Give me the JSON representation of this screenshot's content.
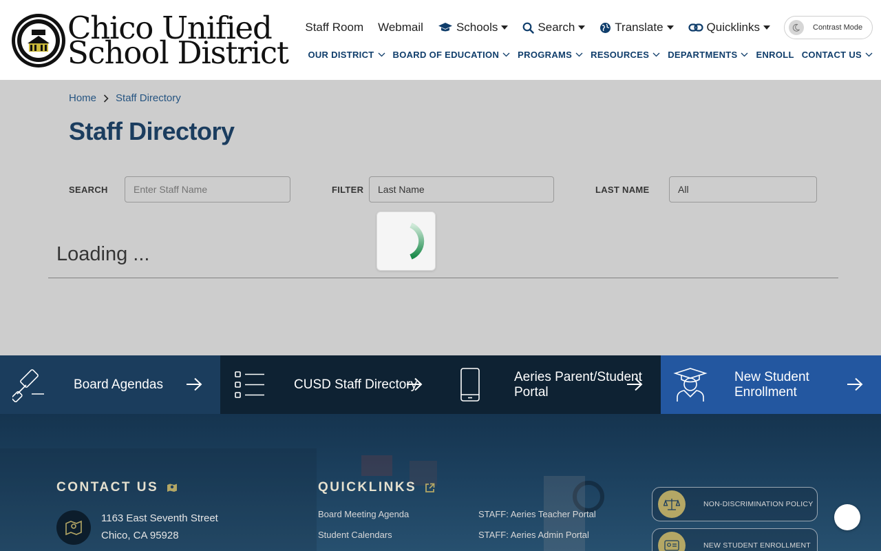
{
  "logo": {
    "line1": "Chico Unified",
    "line2": "School District"
  },
  "utility_nav": {
    "staff_room": "Staff Room",
    "webmail": "Webmail",
    "schools": "Schools",
    "search": "Search",
    "translate": "Translate",
    "quicklinks": "Quicklinks",
    "contrast_mode": "Contrast Mode"
  },
  "main_nav": {
    "our_district": "OUR DISTRICT",
    "board_of_education": "BOARD OF EDUCATION",
    "programs": "PROGRAMS",
    "resources": "RESOURCES",
    "departments": "DEPARTMENTS",
    "enroll": "ENROLL",
    "contact_us": "CONTACT US"
  },
  "breadcrumb": {
    "home": "Home",
    "current": "Staff Directory"
  },
  "page_title": "Staff Directory",
  "filters": {
    "search_label": "SEARCH",
    "search_placeholder": "Enter Staff Name",
    "filter_label": "FILTER",
    "filter_value": "Last Name",
    "lastname_label": "LAST NAME",
    "lastname_value": "All"
  },
  "loading_text": "Loading ...",
  "tiles": [
    {
      "label": "Board Agendas",
      "bg": "#1b3d5d",
      "icon": "gavel-icon"
    },
    {
      "label": "CUSD Staff Directory",
      "bg": "#0e2233",
      "icon": "list-icon"
    },
    {
      "label": "Aeries Parent/Student Portal",
      "bg": "#0e2233",
      "icon": "mobile-icon"
    },
    {
      "label": "New Student Enrollment",
      "bg": "#2357a0",
      "icon": "graduate-icon"
    }
  ],
  "footer": {
    "contact_heading": "CONTACT US",
    "address_line1": "1163 East Seventh Street",
    "address_line2": "Chico, CA 95928",
    "quicklinks_heading": "QUICKLINKS",
    "links": {
      "board_meeting_agenda": "Board Meeting Agenda",
      "student_calendars": "Student Calendars",
      "aeries_teacher": "STAFF: Aeries Teacher Portal",
      "aeries_admin": "STAFF: Aeries Admin Portal"
    },
    "policy_buttons": {
      "non_discrimination": "NON-DISCRIMINATION POLICY",
      "new_enrollment": "NEW STUDENT ENROLLMENT"
    }
  },
  "colors": {
    "brand_navy": "#0f3d6b",
    "link_blue": "#1d5c99",
    "spinner_green": "#1a8a4a",
    "gold": "#b4a765"
  }
}
